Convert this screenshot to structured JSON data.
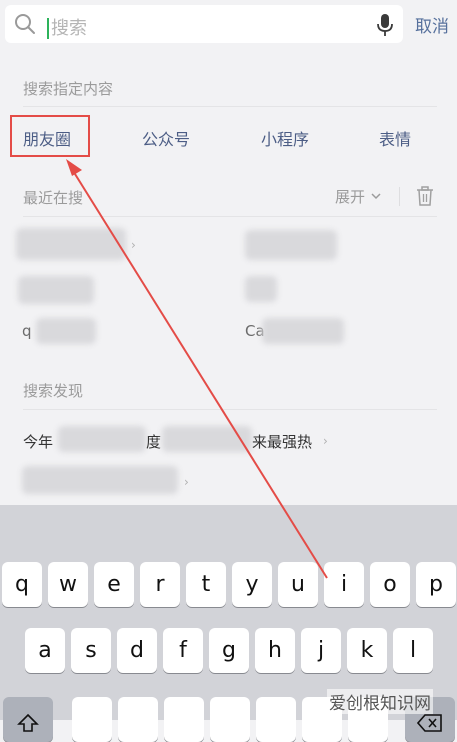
{
  "search": {
    "placeholder": "搜索",
    "cancel_label": "取消"
  },
  "search_specified": {
    "title": "搜索指定内容",
    "categories": [
      "朋友圈",
      "公众号",
      "小程序",
      "表情"
    ]
  },
  "recent": {
    "title": "最近在搜",
    "expand_label": "展开",
    "fragments": [
      "q",
      "Ca"
    ]
  },
  "discover": {
    "title": "搜索发现",
    "items": [
      "今年",
      "度",
      "来最强热"
    ]
  },
  "keyboard": {
    "row1": [
      "q",
      "w",
      "e",
      "r",
      "t",
      "y",
      "u",
      "i",
      "o",
      "p"
    ],
    "row2": [
      "a",
      "s",
      "d",
      "f",
      "g",
      "h",
      "j",
      "k",
      "l"
    ]
  },
  "watermark": "爱创根知识网",
  "colors": {
    "accent": "#56709c",
    "highlight_box": "#e44c47",
    "caret": "#2db35b"
  }
}
